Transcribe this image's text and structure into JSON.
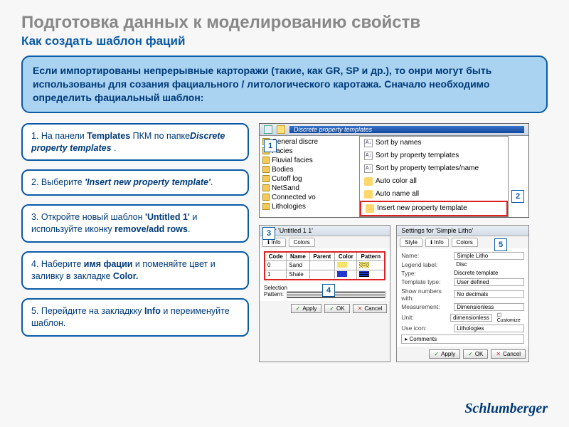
{
  "title": "Подготовка данных к моделированию свойств",
  "subtitle": "Как создать шаблон фаций",
  "intro": "Если импортированы непрерывные карторажи (такие, как GR, SP и др.), то онри могут быть использованы для созания фациального / литологического каротажа. Сначало необходимо определить фациальный шаблон:",
  "steps": {
    "s1": {
      "plain1": "1. На панели ",
      "b1": "Templates",
      "plain2": " ПКМ по папке",
      "b2": "Discrete property templates",
      "plain3": " ."
    },
    "s2": {
      "plain1": "2. Выберите ",
      "b1": "'Insert new property template'",
      "plain2": "."
    },
    "s3": {
      "plain1": "3. Откройте новый шаблон ",
      "b1": "'Untitled 1'",
      "plain2": " и используйте иконку ",
      "b2": "remove/add rows",
      "plain3": "."
    },
    "s4": {
      "plain1": "4. Наберите ",
      "b1": "имя фации",
      "plain2": " и поменяйте цвет и заливку в закладке ",
      "b2": "Color.",
      "plain3": ""
    },
    "s5": {
      "plain1": "5. Перейдите на закладкку ",
      "b1": "Info",
      "plain2": " и переименуйте шаблон."
    }
  },
  "badges": {
    "b1": "1",
    "b2": "2",
    "b3": "3",
    "b4": "4",
    "b5": "5"
  },
  "tree": {
    "header": "Discrete property templates",
    "items": [
      "General discre",
      "Facies",
      "Fluvial facies",
      "Bodies",
      "Cutoff log",
      "NetSand",
      "Connected vo",
      "Lithologies"
    ]
  },
  "menu": {
    "items": [
      "Sort by names",
      "Sort by property templates",
      "Sort by property templates/name",
      "Auto color all",
      "Auto name all"
    ],
    "highlight": "Insert new property template"
  },
  "dlg1": {
    "title": "s for 'Untitled 1 1'",
    "tabs": [
      "Info",
      "Colors"
    ],
    "table": {
      "headers": [
        "Code",
        "Name",
        "Parent",
        "Color",
        "Pattern"
      ],
      "rows": [
        {
          "code": "0",
          "name": "Sand",
          "parent": "",
          "color": "#f7e26b",
          "pattern": "dots"
        },
        {
          "code": "1",
          "name": "Shale",
          "parent": "",
          "color": "#2137d0",
          "pattern": "hatch"
        }
      ]
    },
    "selection_label": "Selection",
    "pattern_label": "Pattern:",
    "buttons": {
      "apply": "Apply",
      "ok": "OK",
      "cancel": "Cancel"
    }
  },
  "dlg2": {
    "title": "Settings for 'Simple Litho'",
    "tabs": [
      "Style",
      "Info",
      "Colors"
    ],
    "rows": {
      "name": {
        "label": "Name:",
        "value": "Simple Litho"
      },
      "legend": {
        "label": "Legend label:",
        "value": "Disc"
      },
      "type": {
        "label": "Type:",
        "value": "Discrete template"
      },
      "tmpl": {
        "label": "Template type:",
        "value": "User defined"
      },
      "show": {
        "label": "Show numbers with:",
        "value": "No decimals"
      },
      "meas": {
        "label": "Measurement:",
        "value": "Dimensionless"
      },
      "unit": {
        "label": "Unit:",
        "value": "dimensionless",
        "cust": "Customize"
      },
      "icon": {
        "label": "Use icon:",
        "value": "Lithologies"
      }
    },
    "comments": "Comments",
    "buttons": {
      "apply": "Apply",
      "ok": "OK",
      "cancel": "Cancel"
    }
  },
  "logo": "Schlumberger"
}
